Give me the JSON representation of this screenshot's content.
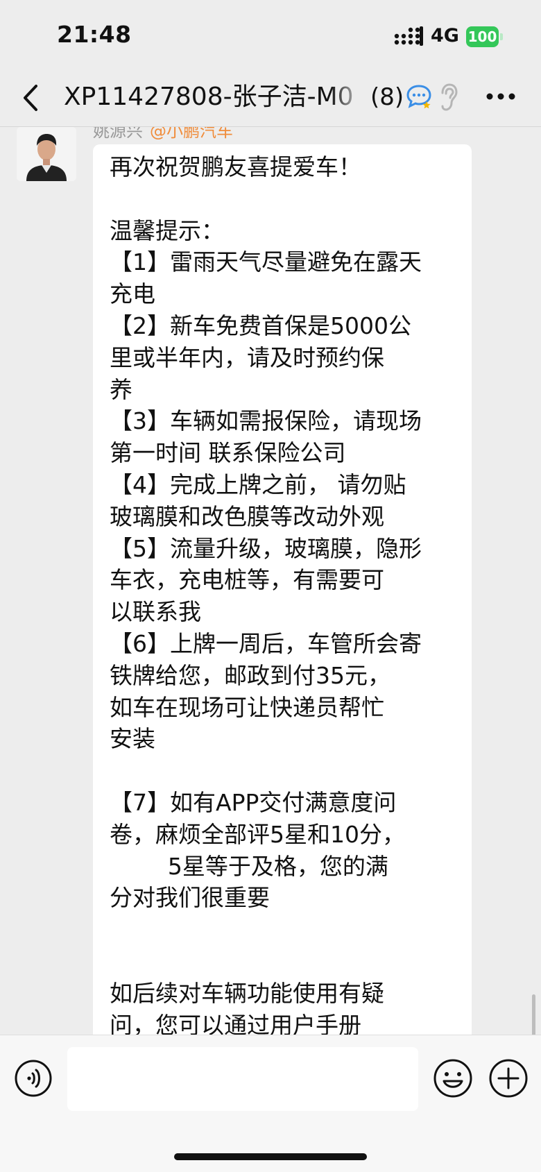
{
  "status_bar": {
    "time": "21:48",
    "network": "4G",
    "battery": "100",
    "battery_color": "#34c759"
  },
  "header": {
    "title": "XP11427808-张子洁-M0",
    "member_count": "(8)",
    "icons": [
      "back-icon",
      "chat-icon",
      "ear-icon",
      "more-icon"
    ]
  },
  "message": {
    "sender": "姚源兴",
    "mention": "@小鹏汽车",
    "text": "再次祝贺鹏友喜提爱车！\n\n温馨提示：\n【1】雷雨天气尽量避免在露天\n充电\n【2】新车免费首保是5000公\n里或半年内，请及时预约保\n养\n【3】车辆如需报保险，请现场\n第一时间 联系保险公司\n【4】完成上牌之前， 请勿贴\n玻璃膜和改色膜等改动外观\n【5】流量升级，玻璃膜，隐形\n车衣，充电桩等，有需要可\n以联系我\n【6】上牌一周后，车管所会寄\n铁牌给您，邮政到付35元，\n如车在现场可让快递员帮忙\n安装\n\n【7】如有APP交付满意度问\n卷，麻烦全部评5星和10分，\n        5星等于及格，您的满\n分对我们很重要\n\n\n如后续对车辆功能使用有疑\n问，您可以通过用户手册"
  },
  "input_bar": {
    "placeholder": "",
    "icons": [
      "voice-icon",
      "emoji-icon",
      "add-icon"
    ]
  },
  "colors": {
    "background": "#ededed",
    "bubble": "#ffffff",
    "mention": "#f08d3c",
    "chat_icon_blue": "#3a8ee6"
  }
}
